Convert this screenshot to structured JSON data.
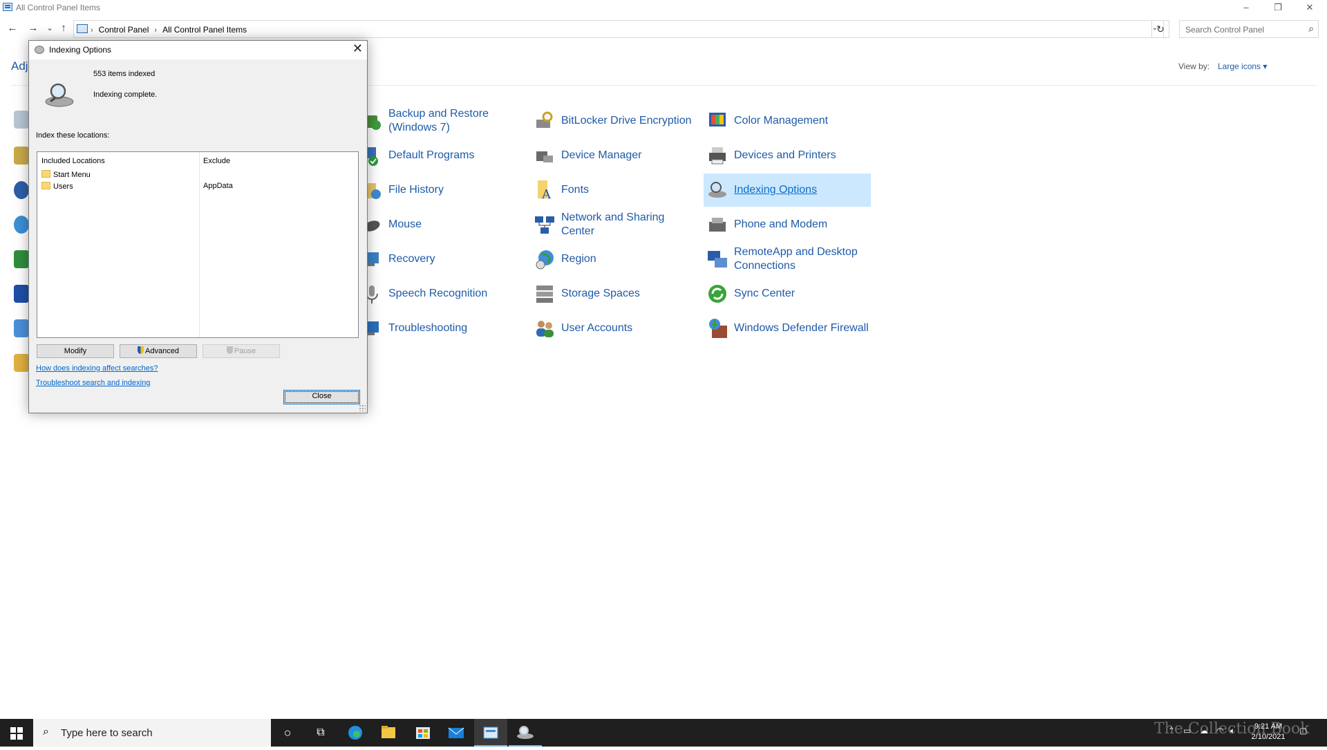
{
  "window": {
    "title": "All Control Panel Items",
    "minimize": "–",
    "restore": "❐",
    "close": "✕"
  },
  "nav": {
    "back": "←",
    "forward": "→",
    "recent": "⌄",
    "up": "↑",
    "breadcrumb": [
      "Control Panel",
      "All Control Panel Items"
    ],
    "breadcrumb_separator": "›",
    "dropdown": "⌄",
    "refresh": "↻",
    "search_placeholder": "Search Control Panel",
    "search_icon": "⌕"
  },
  "header": {
    "heading_partial": "Adj",
    "view_by_label": "View by:",
    "view_by_value": "Large icons ▾"
  },
  "items": [
    {
      "label": "Backup and Restore (Windows 7)",
      "icon": "backup-icon"
    },
    {
      "label": "BitLocker Drive Encryption",
      "icon": "bitlocker-icon"
    },
    {
      "label": "Color Management",
      "icon": "color-management-icon"
    },
    {
      "label": "Default Programs",
      "icon": "default-programs-icon"
    },
    {
      "label": "Device Manager",
      "icon": "device-manager-icon"
    },
    {
      "label": "Devices and Printers",
      "icon": "printer-icon"
    },
    {
      "label": "File History",
      "icon": "file-history-icon"
    },
    {
      "label": "Fonts",
      "icon": "fonts-icon"
    },
    {
      "label": "Indexing Options",
      "icon": "indexing-icon",
      "selected": true
    },
    {
      "label": "Mouse",
      "icon": "mouse-icon"
    },
    {
      "label": "Network and Sharing Center",
      "icon": "network-icon"
    },
    {
      "label": "Phone and Modem",
      "icon": "phone-modem-icon"
    },
    {
      "label": "Recovery",
      "icon": "recovery-icon"
    },
    {
      "label": "Region",
      "icon": "region-icon"
    },
    {
      "label": "RemoteApp and Desktop Connections",
      "icon": "remoteapp-icon"
    },
    {
      "label": "Speech Recognition",
      "icon": "microphone-icon"
    },
    {
      "label": "Storage Spaces",
      "icon": "storage-spaces-icon"
    },
    {
      "label": "Sync Center",
      "icon": "sync-icon"
    },
    {
      "label": "Troubleshooting",
      "icon": "troubleshooting-icon"
    },
    {
      "label": "User Accounts",
      "icon": "user-accounts-icon"
    },
    {
      "label": "Windows Defender Firewall",
      "icon": "firewall-icon"
    }
  ],
  "dialog": {
    "title": "Indexing Options",
    "close_glyph": "✕",
    "items_indexed": "553 items indexed",
    "status": "Indexing complete.",
    "index_label": "Index these locations:",
    "col_included": "Included Locations",
    "col_exclude": "Exclude",
    "locations": [
      {
        "name": "Start Menu",
        "exclude": ""
      },
      {
        "name": "Users",
        "exclude": "AppData"
      }
    ],
    "btn_modify": "Modify",
    "btn_advanced": "Advanced",
    "btn_pause": "Pause",
    "link_affect": "How does indexing affect searches?",
    "link_troubleshoot": "Troubleshoot search and indexing",
    "btn_close": "Close"
  },
  "taskbar": {
    "search_placeholder": "Type here to search",
    "search_icon": "⌕",
    "cortana": "○",
    "taskview": "⧉",
    "time": "9:21 AM",
    "date": "2/10/2021",
    "watermark": "The Collection Book"
  },
  "colors": {
    "link_blue": "#1e5aa8",
    "selected_bg": "#cce8ff",
    "taskbar_bg": "#1f1f1f"
  }
}
